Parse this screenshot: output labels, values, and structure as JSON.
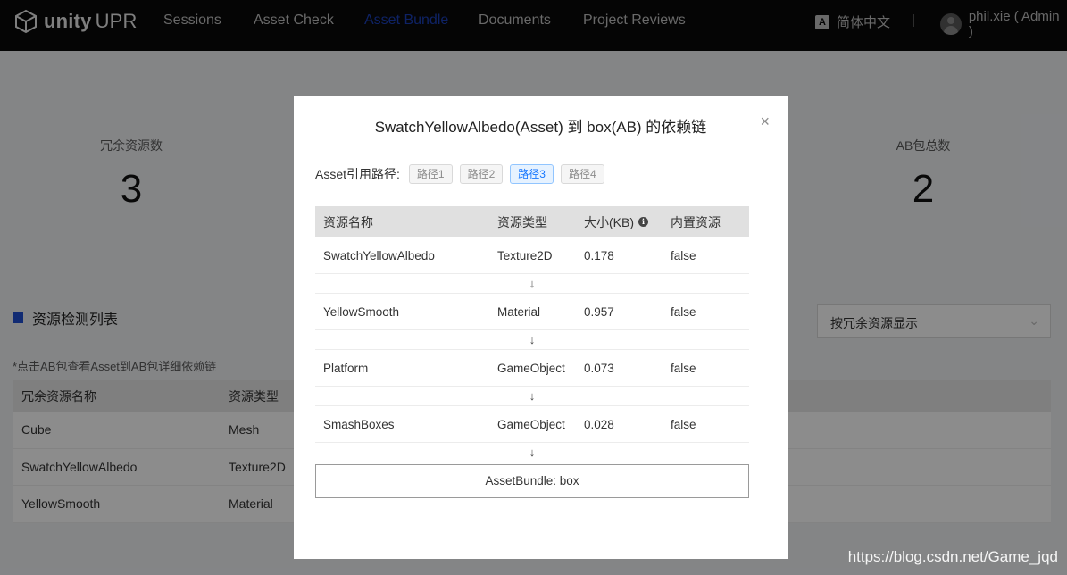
{
  "nav": {
    "brand": "unity",
    "product": "UPR",
    "items": [
      {
        "label": "Sessions",
        "active": false
      },
      {
        "label": "Asset Check",
        "active": false
      },
      {
        "label": "Asset Bundle",
        "active": true
      },
      {
        "label": "Documents",
        "active": false
      },
      {
        "label": "Project Reviews",
        "active": false
      }
    ],
    "language": "简体中文",
    "separator": "|",
    "user": "phil.xie ( Admin )"
  },
  "stats": [
    {
      "label": "冗余资源数",
      "value": "3"
    },
    {
      "label": "AB包总数",
      "value": "2"
    }
  ],
  "list": {
    "title": "资源检测列表",
    "filter_value": "按冗余资源显示",
    "hint": "*点击AB包查看Asset到AB包详细依赖链",
    "columns": [
      "冗余资源名称",
      "资源类型"
    ],
    "rows": [
      [
        "Cube",
        "Mesh"
      ],
      [
        "SwatchYellowAlbedo",
        "Texture2D"
      ],
      [
        "YellowSmooth",
        "Material"
      ]
    ]
  },
  "modal": {
    "title": "SwatchYellowAlbedo(Asset) 到 box(AB) 的依赖链",
    "close": "×",
    "path_label": "Asset引用路径:",
    "paths": [
      {
        "label": "路径1",
        "active": false
      },
      {
        "label": "路径2",
        "active": false
      },
      {
        "label": "路径3",
        "active": true
      },
      {
        "label": "路径4",
        "active": false
      }
    ],
    "columns": [
      "资源名称",
      "资源类型",
      "大小(KB)",
      "内置资源"
    ],
    "rows": [
      [
        "SwatchYellowAlbedo",
        "Texture2D",
        "0.178",
        "false"
      ],
      [
        "YellowSmooth",
        "Material",
        "0.957",
        "false"
      ],
      [
        "Platform",
        "GameObject",
        "0.073",
        "false"
      ],
      [
        "SmashBoxes",
        "GameObject",
        "0.028",
        "false"
      ]
    ],
    "arrow": "↓",
    "bundle": "AssetBundle: box"
  },
  "watermark": "https://blog.csdn.net/Game_jqd",
  "colors": {
    "accent": "#1b3fb8",
    "active_tag": "#1677ff"
  }
}
